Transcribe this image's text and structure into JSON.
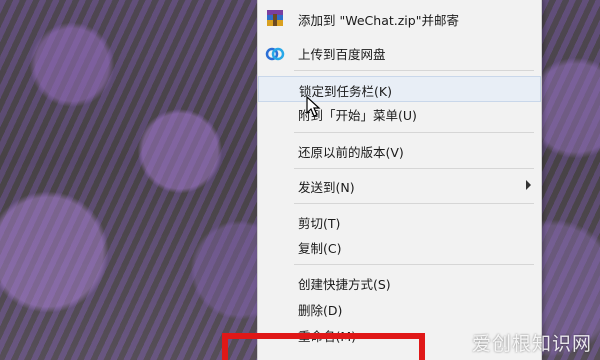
{
  "menu": {
    "items": [
      {
        "label": "添加到 \"WeChat.zip\"并邮寄",
        "icon": "winrar-archive-icon"
      },
      {
        "label": "上传到百度网盘",
        "icon": "baidu-netdisk-icon"
      },
      {
        "label": "锁定到任务栏(K)",
        "state": "hover"
      },
      {
        "label": "附到「开始」菜单(U)"
      },
      {
        "label": "还原以前的版本(V)"
      },
      {
        "label": "发送到(N)",
        "submenu": true
      },
      {
        "label": "剪切(T)"
      },
      {
        "label": "复制(C)"
      },
      {
        "label": "创建快捷方式(S)"
      },
      {
        "label": "删除(D)"
      },
      {
        "label": "重命名(M)"
      }
    ]
  },
  "highlight_color": "#e01818",
  "watermark": "爱创根知识网"
}
